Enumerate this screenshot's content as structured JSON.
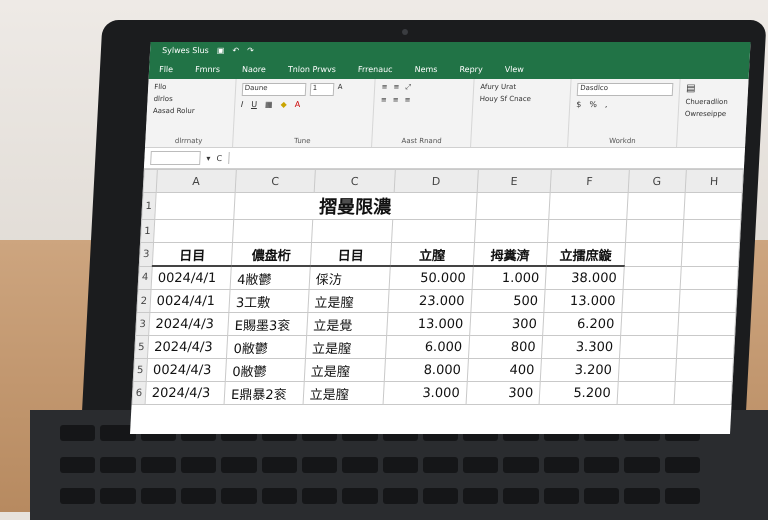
{
  "window": {
    "title": "Sylwes Slus",
    "qat_icons": [
      "save-icon",
      "undo-icon",
      "redo-icon"
    ]
  },
  "ribbon": {
    "tabs": [
      "Flle",
      "Fmnrs",
      "Naore",
      "Tnlon Prwvs",
      "Frrenauc",
      "Nems",
      "Repry",
      "Vlew"
    ],
    "clipboard": {
      "items": [
        "Fllo",
        "dlrlos",
        "Aasad Rolur"
      ],
      "label": "dlrrnaty"
    },
    "font": {
      "name": "Daune",
      "size": "1",
      "label": "Tune"
    },
    "alignment": {
      "label": "Aast Rnand"
    },
    "wrap": {
      "line1": "Afury Urat",
      "line2": "Houy Sf Cnace"
    },
    "number": {
      "format": "Dasdlco",
      "label": "Workdn"
    },
    "styles": {
      "line1": "Chueradlion",
      "line2": "Owreseippe"
    }
  },
  "formula_bar": {
    "name_box": "",
    "fx_label": "C"
  },
  "sheet": {
    "col_headers": [
      "A",
      "C",
      "C",
      "D",
      "E",
      "F",
      "G",
      "H"
    ],
    "row_headers": [
      "1",
      "1",
      "3",
      "4",
      "2",
      "3",
      "5",
      "5",
      "6",
      ""
    ],
    "title": "摺曼限濃",
    "header": [
      "日目",
      "儂盘桁",
      "日目",
      "立膣",
      "拇糞濟",
      "立擂庶鏇"
    ],
    "rows": [
      [
        "0024/4/1",
        "4敝鬱",
        "倸汸",
        "50.000",
        "1.000",
        "38.000"
      ],
      [
        "0024/4/1",
        "3工敷",
        "立是膣",
        "23.000",
        "500",
        "13.000"
      ],
      [
        "2024/4/3",
        "E賜墨3衮",
        "立是覺",
        "13.000",
        "300",
        "6.200"
      ],
      [
        "2024/4/3",
        "0敝鬱",
        "立是膣",
        "6.000",
        "800",
        "3.300"
      ],
      [
        "0024/4/3",
        "0敝鬱",
        "立是膣",
        "8.000",
        "400",
        "3.200"
      ],
      [
        "2024/4/3",
        "E鼎暴2衮",
        "立是膣",
        "3.000",
        "300",
        "5.200"
      ]
    ]
  }
}
